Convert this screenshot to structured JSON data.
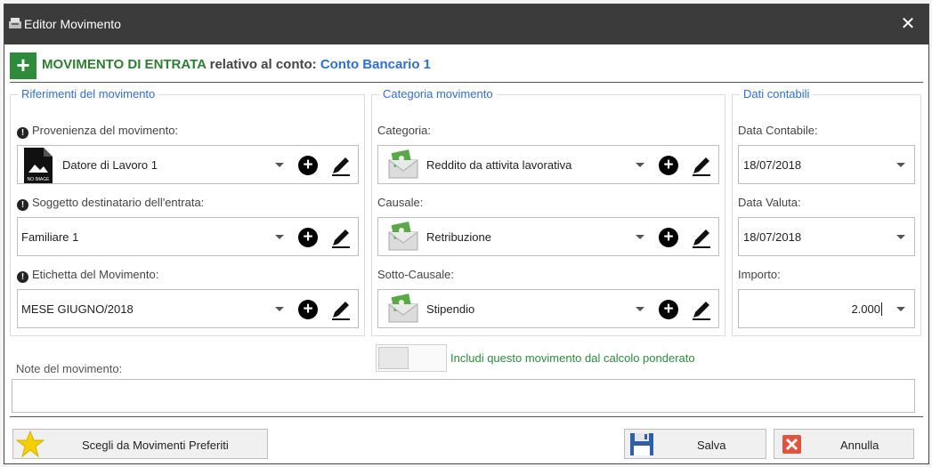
{
  "window": {
    "title": "Editor Movimento",
    "close_glyph": "✕"
  },
  "header": {
    "type_label": "MOVIMENTO DI ENTRATA",
    "relative_text": " relativo al conto: ",
    "account_name": "Conto Bancario 1",
    "accent_color": "#2e8b3c"
  },
  "groups": {
    "riferimenti": {
      "title": "Riferimenti del movimento",
      "provenienza_label": "Provenienza del movimento:",
      "provenienza_value": "Datore di Lavoro 1",
      "soggetto_label": "Soggetto destinatario dell'entrata:",
      "soggetto_value": "Familiare 1",
      "etichetta_label": "Etichetta del Movimento:",
      "etichetta_value": "MESE GIUGNO/2018"
    },
    "categoria": {
      "title": "Categoria movimento",
      "categoria_label": "Categoria:",
      "categoria_value": "Reddito da attivita lavorativa",
      "causale_label": "Causale:",
      "causale_value": "Retribuzione",
      "sotto_label": "Sotto-Causale:",
      "sotto_value": "Stipendio"
    },
    "contabili": {
      "title": "Dati contabili",
      "data_contabile_label": "Data Contabile:",
      "data_contabile_value": "18/07/2018",
      "data_valuta_label": "Data Valuta:",
      "data_valuta_value": "18/07/2018",
      "importo_label": "Importo:",
      "importo_value": "2.000"
    }
  },
  "notes": {
    "label": "Note del movimento:",
    "value": ""
  },
  "toggle": {
    "label": "Includi questo movimento dal calcolo ponderato",
    "checked": false
  },
  "buttons": {
    "preferiti": "Scegli da Movimenti Preferiti",
    "salva": "Salva",
    "annulla": "Annulla"
  },
  "icons": {
    "warning": "!",
    "add": "+",
    "noimage_text": "NO IMAGE"
  },
  "colors": {
    "accent_blue": "#2f6fd6",
    "accent_green": "#2e8b3c",
    "titlebar": "#3b3b3b"
  }
}
